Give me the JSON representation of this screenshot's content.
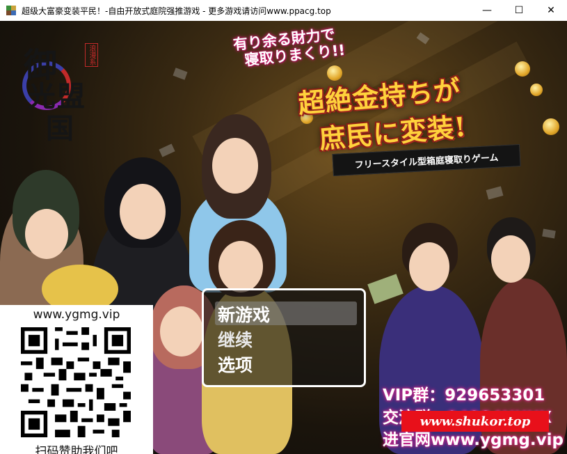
{
  "window": {
    "title": "超级大富豪变装平民！-自由开放式庭院强推游戏 - 更多游戏请访问www.ppacg.top",
    "minimize_glyph": "—",
    "maximize_glyph": "☐",
    "close_glyph": "✕"
  },
  "title_screen": {
    "logo_chars": [
      "御",
      "光",
      "盟",
      "国"
    ],
    "logo_tag": "浪漫系",
    "catchcopy": [
      "有り余る財力で",
      "寝取りまくり!!"
    ],
    "headline_line1": "超絶金持ちが",
    "headline_line2": "庶民に変装!",
    "subtitle": "フリースタイル型箱庭寝取りゲーム"
  },
  "menu": {
    "items": [
      "新游戏",
      "继续",
      "选项"
    ],
    "selected_index": 0
  },
  "promo": {
    "qr_url": "www.ygmg.vip",
    "qr_caption": "扫码赞助我们吧",
    "vip_line": "VIP群：929653301",
    "exchange_line": "交流群：94384XXXX",
    "website_line": "进官网www.ygmg.vip",
    "shukor_banner": "www.shukor.top"
  },
  "colors": {
    "headline": "#ffd23c",
    "catch_glow": "#d0186f",
    "vip_glow": "#e0248c",
    "banner_red": "#e8101a"
  }
}
